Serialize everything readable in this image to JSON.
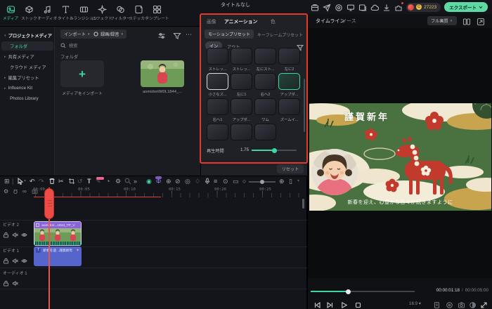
{
  "titlebar": {
    "title": "タイトルなし",
    "credits": "27223",
    "coin_glyph": "C",
    "export_label": "エクスポート",
    "icon_names": [
      "storage-icon",
      "share-icon",
      "capture-icon",
      "display-icon",
      "media-library-icon",
      "cloud-icon",
      "download-icon",
      "plugins-icon",
      "avatar-icon",
      "coin-icon"
    ]
  },
  "top_nav": {
    "items": [
      {
        "label": "メディア",
        "active": true
      },
      {
        "label": "ストック"
      },
      {
        "label": "オーディオ"
      },
      {
        "label": "タイトル"
      },
      {
        "label": "トランジション"
      },
      {
        "label": "エフェクト"
      },
      {
        "label": "フィルター"
      },
      {
        "label": "ステッカー"
      },
      {
        "label": "テンプレート"
      }
    ]
  },
  "sidebar": {
    "items": [
      {
        "label": "プロジェクトメディア",
        "expanded": true
      },
      {
        "label": "フォルダ",
        "selected": true
      },
      {
        "label": "共有メディア"
      },
      {
        "label": "クラウド メディア"
      },
      {
        "label": "編集プリセット"
      },
      {
        "label": "Influence Kit"
      },
      {
        "label": "Photos Library"
      }
    ]
  },
  "media_panel": {
    "import_button": "インポート",
    "record_button": "録画/録音",
    "search_placeholder": "検索",
    "section_title": "フォルダ",
    "import_tile_label": "メディアをインポート",
    "media_item_name": "aomidoriIM0L1844_...",
    "icon_names": [
      "sliders-icon",
      "funnel-icon",
      "more-icon",
      "search-icon"
    ]
  },
  "animation_panel": {
    "tabs": [
      {
        "label": "画像"
      },
      {
        "label": "アニメーション",
        "active": true
      },
      {
        "label": "色"
      }
    ],
    "preset_tabs": [
      {
        "label": "モーションプリセット",
        "active": true
      },
      {
        "label": "キーフレームプリセット"
      }
    ],
    "direction_tabs": [
      {
        "label": "イン",
        "active": true
      },
      {
        "label": "アウト"
      }
    ],
    "presets": [
      {
        "label": "ストレッ..."
      },
      {
        "label": "ストレッ..."
      },
      {
        "label": "左にスト..."
      },
      {
        "label": "左に2"
      },
      {
        "label": "小さなズ...",
        "hover": true
      },
      {
        "label": "左に1"
      },
      {
        "label": "右へ2"
      },
      {
        "label": "アップダ...",
        "selected": true
      },
      {
        "label": "右へ1"
      },
      {
        "label": "アップダ..."
      },
      {
        "label": "ワム"
      },
      {
        "label": "ズームイ..."
      }
    ],
    "duration_label": "再生時間",
    "duration_value": "1.75",
    "reset_label": "リセット"
  },
  "preview": {
    "tabs": [
      {
        "label": "タイムライン",
        "active": true
      },
      {
        "label": "ソース"
      }
    ],
    "quality_selector": "フル画質",
    "aspect_ratio": "16:9",
    "current_time": "00:00:01:18",
    "time_separator": "/",
    "total_time": "00:00:05:00",
    "card": {
      "title": "謹賀新年",
      "caption": "新春を迎え、心豊かな日々が続きますように"
    },
    "icon_names": [
      "columns-icon",
      "expand-icon",
      "skip-back-icon",
      "step-forward-icon",
      "play-icon",
      "stop-icon",
      "script-icon",
      "render-icon",
      "snapshot-icon",
      "contrast-icon",
      "resize-icon"
    ]
  },
  "timeline": {
    "ruler_labels": [
      "00:00",
      "00:05",
      "00:10",
      "00:15",
      "00:20",
      "00:25"
    ],
    "tracks": [
      {
        "name": "ビデオ 2"
      },
      {
        "name": "ビデオ 1"
      },
      {
        "name": "オーディオ 1"
      }
    ],
    "clips": [
      {
        "name": "aomidori...1844_TP_V",
        "type": "video"
      },
      {
        "name": "新春を迎...謹賀新年",
        "type": "title"
      }
    ],
    "toolbar_icon_names": [
      "media-view-icon",
      "cursor-icon",
      "undo-icon",
      "redo-icon",
      "trash-icon",
      "split-icon",
      "crop-icon",
      "rotate-icon",
      "text-icon",
      "pen-icon",
      "speed-icon",
      "settings-icon",
      "zoom-icon",
      "more-tools-icon",
      "mask-icon",
      "chroma-icon",
      "stabilize-icon",
      "denoise-icon",
      "compound-icon",
      "marker-icon",
      "mic-icon",
      "mixer-icon",
      "record-icon",
      "frame-export-icon",
      "history-icon",
      "zoom-slider",
      "zoom-fit-icon",
      "track-height-icon",
      "track-gear-icon",
      "magnet-icon",
      "link-icon",
      "snapshot-icon"
    ]
  }
}
